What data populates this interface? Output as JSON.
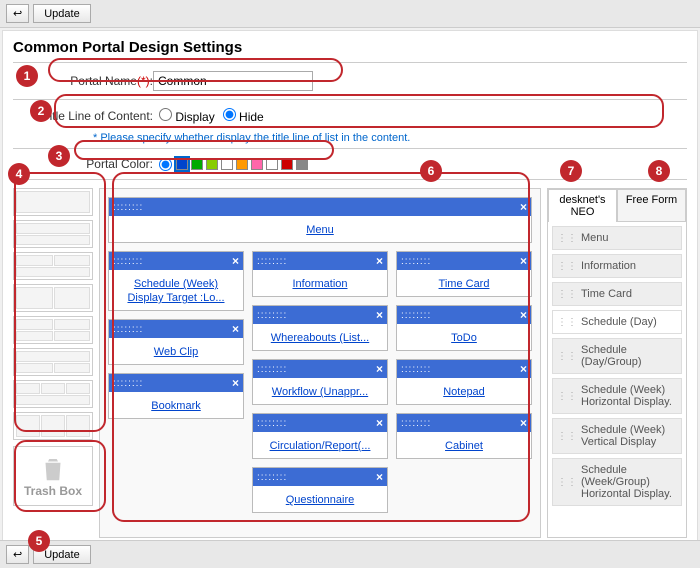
{
  "toolbar": {
    "back": "↩",
    "update": "Update"
  },
  "title": "Common Portal Design Settings",
  "portalName": {
    "label": "Portal Name",
    "required": "(*)",
    "colon": ":",
    "value": "Common"
  },
  "titleLine": {
    "label": "Title Line of Content:",
    "options": [
      "Display",
      "Hide"
    ],
    "note": "* Please specify whether display the title line of list in the content."
  },
  "portalColor": {
    "label": "Portal Color:",
    "colors": [
      "#0044cc",
      "#00aa00",
      "#88cc00",
      "#ffffff",
      "#ff9900",
      "#ff66aa",
      "#ffffff",
      "#cc0000",
      "#888888"
    ]
  },
  "widgets": {
    "full": "Menu",
    "col1": [
      {
        "line1": "Schedule (Week)",
        "line2": "Display Target :Lo..."
      },
      {
        "line1": "Web Clip"
      },
      {
        "line1": "Bookmark"
      }
    ],
    "col2": [
      {
        "line1": "Information"
      },
      {
        "line1": "Whereabouts (List..."
      },
      {
        "line1": "Workflow (Unappr..."
      },
      {
        "line1": "Circulation/Report(..."
      },
      {
        "line1": "Questionnaire"
      }
    ],
    "col3": [
      {
        "line1": "Time Card"
      },
      {
        "line1": "ToDo"
      },
      {
        "line1": "Notepad"
      },
      {
        "line1": "Cabinet"
      }
    ]
  },
  "paletteTabs": [
    "desknet's NEO",
    "Free Form"
  ],
  "paletteItems": [
    {
      "label": "Menu",
      "dark": true
    },
    {
      "label": "Information",
      "dark": true
    },
    {
      "label": "Time Card",
      "dark": true
    },
    {
      "label": "Schedule (Day)",
      "dark": false
    },
    {
      "label": "Schedule (Day/Group)",
      "dark": true
    },
    {
      "label": "Schedule (Week) Horizontal Display.",
      "dark": true
    },
    {
      "label": "Schedule (Week) Vertical Display",
      "dark": true
    },
    {
      "label": "Schedule (Week/Group) Horizontal Display.",
      "dark": true
    }
  ],
  "trash": "Trash Box",
  "callouts": [
    "1",
    "2",
    "3",
    "4",
    "5",
    "6",
    "7",
    "8"
  ]
}
